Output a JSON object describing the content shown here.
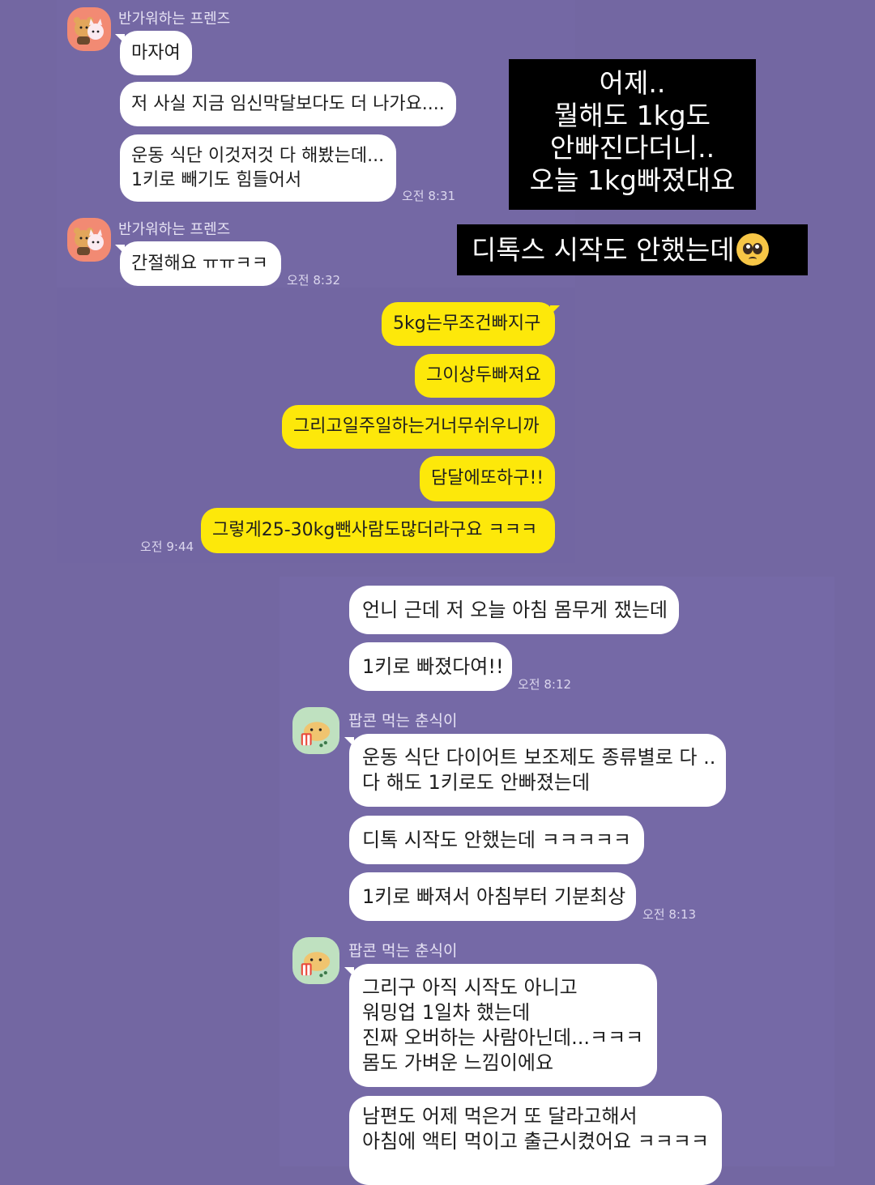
{
  "chat_top": {
    "sender_1": "반가워하는 프렌즈",
    "msg_1": "마자여",
    "msg_2": "저 사실 지금 임신막달보다도 더 나가요....",
    "msg_3_line1": "운동 식단 이것저것 다 해봤는데...",
    "msg_3_line2": "1키로 빼기도 힘들어서",
    "time_1": "오전 8:31",
    "sender_2": "반가워하는 프렌즈",
    "msg_4": "간절해요 ㅠㅠㅋㅋ",
    "time_2": "오전 8:32"
  },
  "captions": {
    "caption_1_lines": [
      "어제..",
      "뭘해도 1kg도",
      "안빠진다더니..",
      "오늘 1kg빠졌대요"
    ],
    "caption_2": "디톡스 시작도 안했는데"
  },
  "chat_mid": {
    "msg_1": "5kg는무조건빠지구",
    "msg_2": "그이상두빠져요",
    "msg_3": "그리고일주일하는거너무쉬우니까",
    "msg_4": "담달에또하구!!",
    "msg_5": "그렇게25-30kg뺀사람도많더라구요 ㅋㅋㅋ",
    "time_1": "오전 9:44"
  },
  "chat_bottom": {
    "msg_1": "언니 근데 저 오늘 아침 몸무게 쟀는데",
    "msg_2": "1키로 빠졌다여!!",
    "time_1": "오전 8:12",
    "sender_1": "팝콘 먹는 춘식이",
    "msg_3_line1": "운동 식단 다이어트 보조제도 종류별로 다 ..",
    "msg_3_line2": "다 해도 1키로도 안빠졌는데",
    "msg_4": "디톡 시작도 안했는데 ㅋㅋㅋㅋㅋ",
    "msg_5": "1키로 빠져서 아침부터 기분최상",
    "time_2": "오전 8:13",
    "sender_2": "팝콘 먹는 춘식이",
    "msg_6_line1": "그리구 아직 시작도 아니고",
    "msg_6_line2": "워밍업 1일차 했는데",
    "msg_6_line3": "진짜 오버하는 사람아닌데...ㅋㅋㅋ",
    "msg_6_line4": "몸도 가벼운 느낌이에요",
    "msg_7_line1": "남편도 어제 먹은거 또 달라고해서",
    "msg_7_line2": "아침에 액티 먹이고 출근시켰어요 ㅋㅋㅋㅋ"
  },
  "colors": {
    "background": "#7367a2",
    "bubble_white": "#ffffff",
    "bubble_yellow": "#fde80a",
    "avatar_pink": "#f28a73",
    "avatar_green": "#bfe1c0",
    "caption_bg": "#000000"
  },
  "icons": {
    "avatar_1": "ryan-apeach-friends-avatar",
    "avatar_2": "choonsik-popcorn-avatar",
    "emoji": "pleading-face-emoji"
  }
}
